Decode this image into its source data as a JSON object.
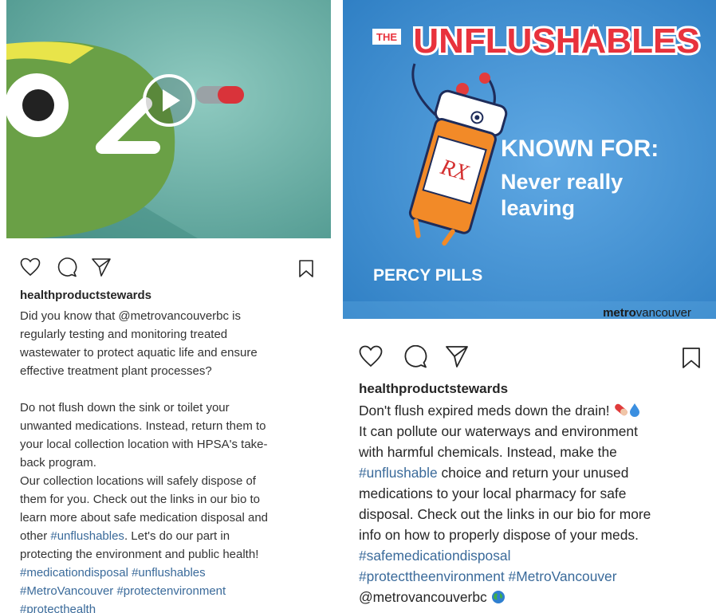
{
  "post_left": {
    "username": "healthproductstewards",
    "caption": [
      [
        "Did you know that @metrovancouverbc is"
      ],
      [
        "regularly testing and monitoring treated"
      ],
      [
        "wastewater to protect aquatic life and ensure"
      ],
      [
        "effective treatment plant processes?"
      ],
      [
        ""
      ],
      [
        "Do not flush down the sink or toilet your"
      ],
      [
        "unwanted medications. Instead, return them to"
      ],
      [
        "your local collection location with HPSA's take-"
      ],
      [
        "back program."
      ],
      [
        "Our collection locations will safely dispose of"
      ],
      [
        "them for you. Check out the links in our bio to"
      ],
      [
        "learn more about safe medication disposal and"
      ]
    ],
    "caption_line13_prefix": "other ",
    "caption_line13_tag": "#unflushables",
    "caption_line13_suffix": ". Let's do our part in",
    "caption_line14": "protecting the environment and public health!",
    "hashtags_line1": "#medicationdisposal #unflushables",
    "hashtags_line2": "#MetroVancouver #protectenvironment",
    "hashtags_line3": "#protecthealth"
  },
  "post_right": {
    "title_small": "THE",
    "title_big": "UNFLUSHABLES",
    "known_for": "KNOWN FOR:",
    "tagline_line1": "Never really",
    "tagline_line2": "leaving",
    "character_name": "PERCY PILLS",
    "bottle_label": "RX",
    "brand_bold": "metro",
    "brand_light": "vancouver",
    "username": "healthproductstewards",
    "line1": "Don't flush expired meds down the drain!",
    "line2": "It can pollute our waterways and environment",
    "line3": "with harmful chemicals.  Instead, make the",
    "line4_tag": "#unflushable",
    "line4_rest": " choice and return your unused",
    "line5": "medications to your local pharmacy for safe",
    "line6": "disposal.  Check out the links in our bio for more",
    "line7": "info on how to properly dispose of your meds.",
    "line8_tag": "#safemedicationdisposal",
    "line9_tag": "#protecttheenvironment #MetroVancouver",
    "line10": "@metrovancouverbc"
  },
  "colors": {
    "hashtag": "#3a6a9a",
    "left_bg": "#5fa59c",
    "right_bg": "#3e8fd2",
    "title_red": "#e8323c"
  },
  "icons": [
    "heart-icon",
    "comment-icon",
    "share-icon",
    "bookmark-icon",
    "play-icon",
    "pill-emoji",
    "droplet-emoji",
    "globe-emoji"
  ]
}
